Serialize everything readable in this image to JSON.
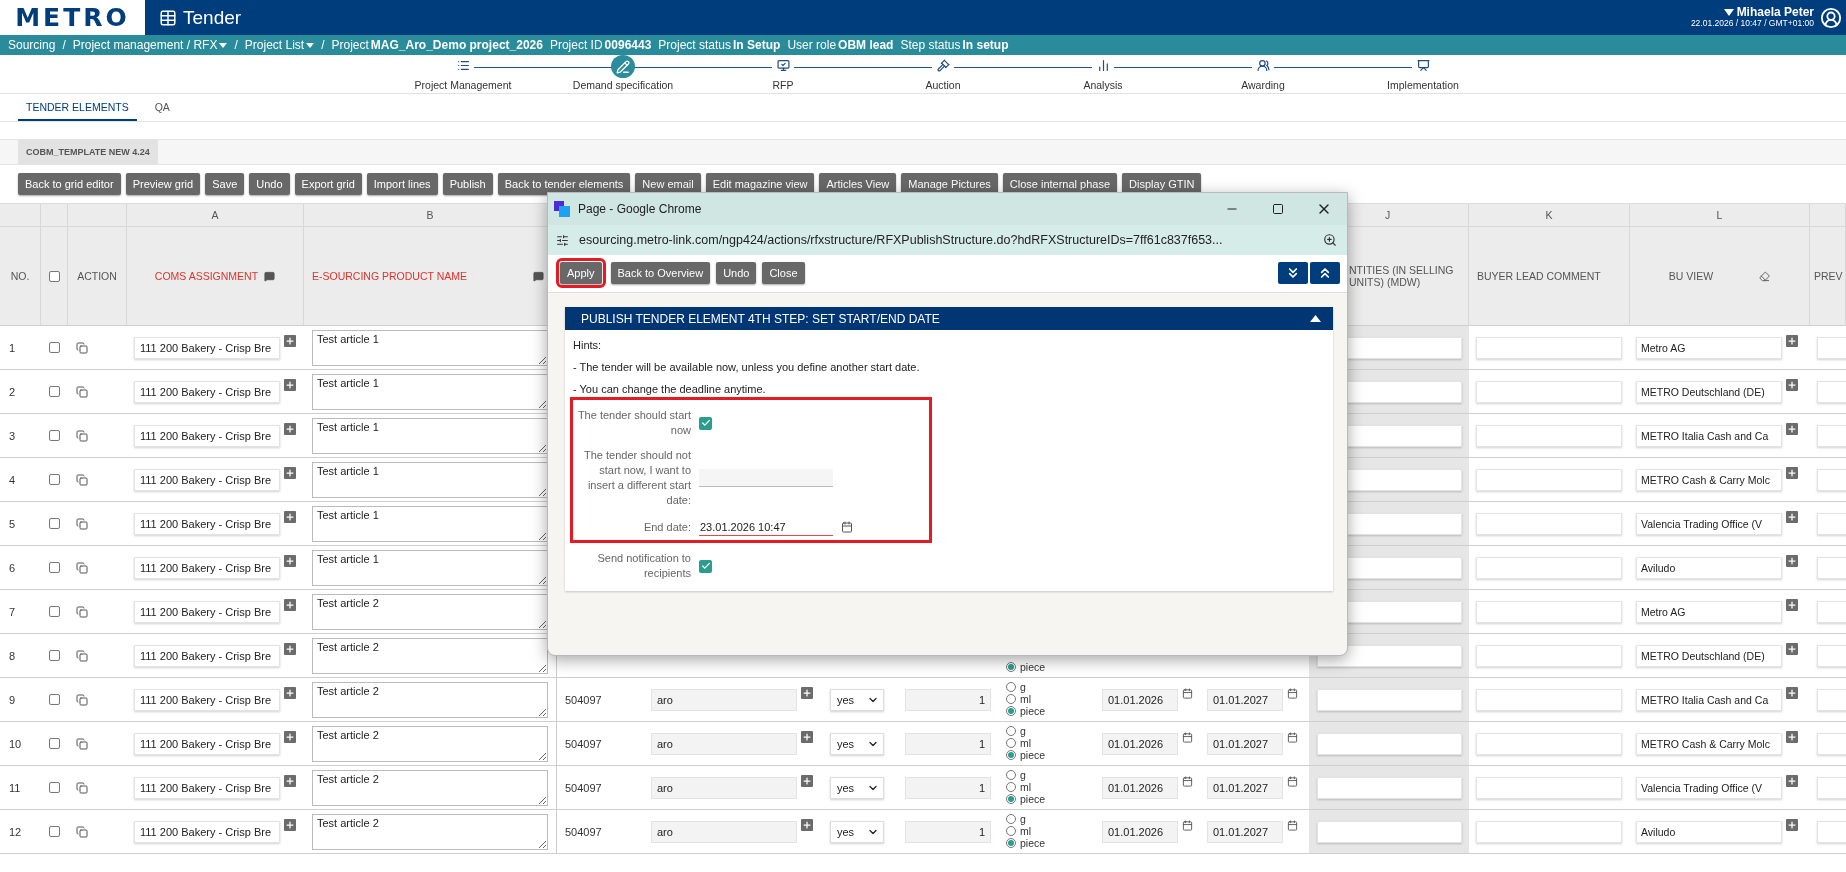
{
  "header": {
    "logo": "METRO",
    "app_title": "Tender",
    "user": "Mihaela Peter",
    "datetime": "22.01.2026 / 10:47 / GMT+01:00"
  },
  "breadcrumb": [
    {
      "kind": "link",
      "label": "Sourcing"
    },
    {
      "kind": "separator",
      "label": "/"
    },
    {
      "kind": "menu",
      "label": "Project management / RFX"
    },
    {
      "kind": "separator",
      "label": "/"
    },
    {
      "kind": "menu",
      "label": "Project List"
    },
    {
      "kind": "separator",
      "label": "/"
    },
    {
      "kind": "info",
      "label": "Project **MAG_Aro_Demo project_2026**"
    },
    {
      "kind": "info",
      "label": "Project ID **0096443**"
    },
    {
      "kind": "info",
      "label": "Project status **In Setup**"
    },
    {
      "kind": "info",
      "label": "User role **OBM lead**"
    },
    {
      "kind": "info",
      "label": "Step status **In setup**"
    }
  ],
  "steps": [
    {
      "label": "Project Management",
      "selected": false
    },
    {
      "label": "Demand specification",
      "selected": true
    },
    {
      "label": "RFP",
      "selected": false
    },
    {
      "label": "Auction",
      "selected": false
    },
    {
      "label": "Analysis",
      "selected": false
    },
    {
      "label": "Awarding",
      "selected": false
    },
    {
      "label": "Implementation",
      "selected": false
    }
  ],
  "tabs": [
    {
      "label": "TENDER ELEMENTS",
      "selected": true
    },
    {
      "label": "QA",
      "selected": false
    }
  ],
  "template_tab": "COBM_TEMPLATE NEW 4.24",
  "toolbar": [
    "Back to grid editor",
    "Preview grid",
    "Save",
    "Undo",
    "Export grid",
    "Import lines",
    "Publish",
    "Back to tender elements",
    "New email",
    "Edit magazine view",
    "Articles View",
    "Manage Pictures",
    "Close internal phase",
    "Display GTIN"
  ],
  "table": {
    "select_all": {
      "checked": false
    },
    "columns": [
      {
        "title": "NO."
      },
      {
        "title": "ACTION"
      },
      {
        "letter": "A",
        "title": "COMS ASSIGNMENT",
        "required": true
      },
      {
        "letter": "B",
        "title": "E-SOURCING PRODUCT NAME",
        "required": true
      },
      {
        "letter": "J",
        "title": "NTITIES (IN SELLING UNITS) (MDW)",
        "required": false
      },
      {
        "letter": "K",
        "title": "BUYER LEAD COMMENT",
        "required": false
      },
      {
        "letter": "L",
        "title": "BU VIEW",
        "required": false
      },
      {
        "title": "PREV"
      }
    ],
    "rows": [
      {
        "no": "1",
        "checked": false,
        "coms": "111 200 Bakery - Crisp Bre",
        "product": "Test article 1",
        "bu_view": "Metro AG"
      },
      {
        "no": "2",
        "checked": false,
        "coms": "111 200 Bakery - Crisp Bre",
        "product": "Test article 1",
        "bu_view": "METRO Deutschland (DE)"
      },
      {
        "no": "3",
        "checked": false,
        "coms": "111 200 Bakery - Crisp Bre",
        "product": "Test article 1",
        "bu_view": "METRO Italia Cash and Ca"
      },
      {
        "no": "4",
        "checked": false,
        "coms": "111 200 Bakery - Crisp Bre",
        "product": "Test article 1",
        "bu_view": "METRO Cash & Carry Molc"
      },
      {
        "no": "5",
        "checked": false,
        "coms": "111 200 Bakery - Crisp Bre",
        "product": "Test article 1",
        "bu_view": "Valencia Trading Office (V"
      },
      {
        "no": "6",
        "checked": false,
        "coms": "111 200 Bakery - Crisp Bre",
        "product": "Test article 1",
        "bu_view": "Aviludo"
      },
      {
        "no": "7",
        "checked": false,
        "coms": "111 200 Bakery - Crisp Bre",
        "product": "Test article 2",
        "bu_view": "Metro AG"
      },
      {
        "no": "8",
        "checked": false,
        "coms": "111 200 Bakery - Crisp Bre",
        "product": "Test article 2",
        "units": [
          {
            "label": "piece",
            "selected": true
          }
        ],
        "bu_view": "METRO Deutschland (DE)"
      },
      {
        "no": "9",
        "checked": false,
        "coms": "111 200 Bakery - Crisp Bre",
        "product": "Test article 2",
        "code": "504097",
        "supplier": "aro",
        "option": "yes",
        "quantity": "1",
        "units": [
          {
            "label": "g",
            "selected": false
          },
          {
            "label": "ml",
            "selected": false
          },
          {
            "label": "piece",
            "selected": true
          }
        ],
        "start": "01.01.2026",
        "end": "01.01.2027",
        "bu_view": "METRO Italia Cash and Ca"
      },
      {
        "no": "10",
        "checked": false,
        "coms": "111 200 Bakery - Crisp Bre",
        "product": "Test article 2",
        "code": "504097",
        "supplier": "aro",
        "option": "yes",
        "quantity": "1",
        "units": [
          {
            "label": "g",
            "selected": false
          },
          {
            "label": "ml",
            "selected": false
          },
          {
            "label": "piece",
            "selected": true
          }
        ],
        "start": "01.01.2026",
        "end": "01.01.2027",
        "bu_view": "METRO Cash & Carry Molc"
      },
      {
        "no": "11",
        "checked": false,
        "coms": "111 200 Bakery - Crisp Bre",
        "product": "Test article 2",
        "code": "504097",
        "supplier": "aro",
        "option": "yes",
        "quantity": "1",
        "units": [
          {
            "label": "g",
            "selected": false
          },
          {
            "label": "ml",
            "selected": false
          },
          {
            "label": "piece",
            "selected": true
          }
        ],
        "start": "01.01.2026",
        "end": "01.01.2027",
        "bu_view": "Valencia Trading Office (V"
      },
      {
        "no": "12",
        "checked": false,
        "coms": "111 200 Bakery - Crisp Bre",
        "product": "Test article 2",
        "code": "504097",
        "supplier": "aro",
        "option": "yes",
        "quantity": "1",
        "units": [
          {
            "label": "g",
            "selected": false
          },
          {
            "label": "ml",
            "selected": false
          },
          {
            "label": "piece",
            "selected": true
          }
        ],
        "start": "01.01.2026",
        "end": "01.01.2027",
        "bu_view": "Aviludo"
      }
    ]
  },
  "dialog": {
    "window_title": "Page - Google Chrome",
    "url": "esourcing.metro-link.com/ngp424/actions/rfxstructure/RFXPublishStructure.do?hdRFXStructureIDs=7ff61c837f653...",
    "buttons": [
      {
        "label": "Apply",
        "highlighted": true
      },
      {
        "label": "Back to Overview",
        "highlighted": false
      },
      {
        "label": "Undo",
        "highlighted": false
      },
      {
        "label": "Close",
        "highlighted": false
      }
    ],
    "section_title": "PUBLISH TENDER ELEMENT 4TH STEP: SET START/END DATE",
    "hints": [
      "Hints:",
      "- The tender will be available now, unless you define another start date.",
      "- You can change the deadline anytime."
    ],
    "highlighted_fields": [
      {
        "kind": "checkbox",
        "label": "The tender should start now",
        "checked": true
      },
      {
        "kind": "date",
        "label": "The tender should not start now, I want to insert a different start date:",
        "has_calendar": false
      },
      {
        "kind": "date",
        "label": "End date:",
        "value": "23.01.2026 10:47",
        "has_calendar": true
      }
    ],
    "fields": [
      {
        "kind": "checkbox",
        "label": "Send notification to recipients",
        "checked": true
      }
    ]
  }
}
